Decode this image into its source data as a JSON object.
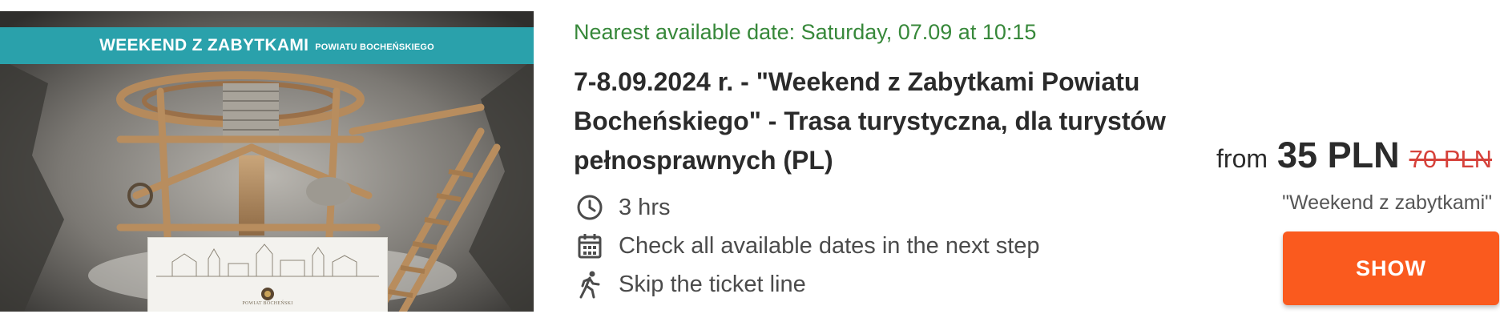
{
  "image": {
    "banner_title": "WEEKEND Z ZABYTKAMI",
    "banner_subtitle": "POWIATU BOCHEŃSKIEGO",
    "panel_caption": "POWIAT BOCHEŃSKI"
  },
  "offer": {
    "nearest_date": "Nearest available date: Saturday, 07.09 at 10:15",
    "title": "7-8.09.2024 r. - \"Weekend z Zabytkami Powiatu Bocheńskiego\" - Trasa turystyczna, dla turystów pełnosprawnych (PL)",
    "features": [
      {
        "icon": "clock-icon",
        "text": "3 hrs"
      },
      {
        "icon": "calendar-icon",
        "text": "Check all available dates in the next step"
      },
      {
        "icon": "running-person-icon",
        "text": "Skip the ticket line"
      }
    ]
  },
  "pricing": {
    "from_label": "from",
    "current_price": "35 PLN",
    "old_price": "70 PLN",
    "note": "\"Weekend z zabytkami\"",
    "button_label": "SHOW"
  },
  "colors": {
    "accent_green": "#37883a",
    "button_orange": "#fa5a1e",
    "old_price_red": "#d6423b",
    "banner_teal": "#2aa1ab"
  }
}
